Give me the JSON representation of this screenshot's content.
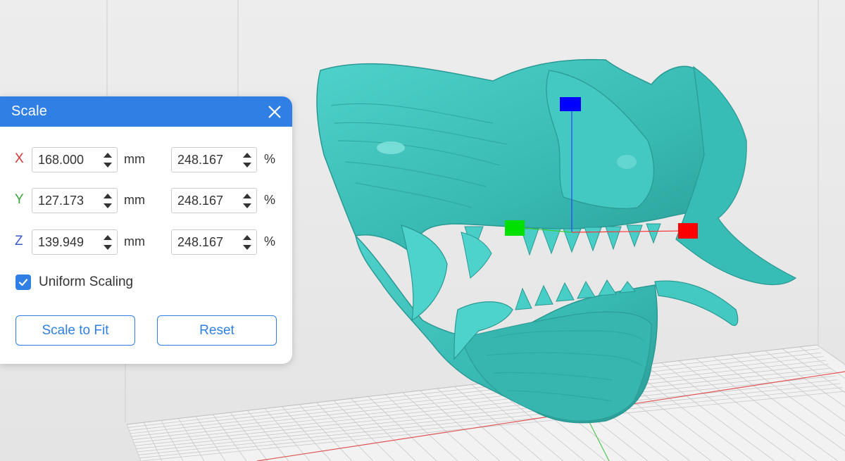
{
  "panel": {
    "title": "Scale",
    "uniform_scaling_label": "Uniform Scaling",
    "uniform_scaling_checked": true,
    "scale_to_fit_label": "Scale to Fit",
    "reset_label": "Reset",
    "rows": [
      {
        "axis": "X",
        "axis_color": "#d23a3a",
        "size": "168.000",
        "size_unit": "mm",
        "percent": "248.167",
        "percent_unit": "%"
      },
      {
        "axis": "Y",
        "axis_color": "#3aa63a",
        "size": "127.173",
        "size_unit": "mm",
        "percent": "248.167",
        "percent_unit": "%"
      },
      {
        "axis": "Z",
        "axis_color": "#3a5cc8",
        "size": "139.949",
        "size_unit": "mm",
        "percent": "248.167",
        "percent_unit": "%"
      }
    ]
  },
  "colors": {
    "accent": "#2f7fe5",
    "model": "#3ec4bd",
    "gizmo_x": "#ff0000",
    "gizmo_y": "#00e000",
    "gizmo_z": "#0000ff"
  }
}
